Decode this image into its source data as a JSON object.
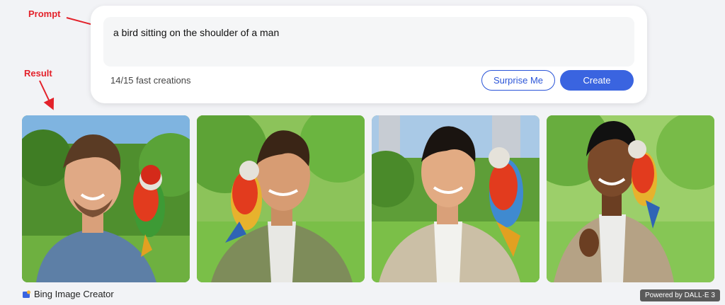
{
  "annotations": {
    "prompt_label": "Prompt",
    "result_label": "Result",
    "color": "#e3222b"
  },
  "prompt": {
    "value": "a bird sitting on the shoulder of a man",
    "fast_creations": "14/15 fast creations"
  },
  "buttons": {
    "surprise_label": "Surprise Me",
    "create_label": "Create"
  },
  "images": [
    {
      "subject": "man-with-parrot-1"
    },
    {
      "subject": "man-with-parrot-2"
    },
    {
      "subject": "man-with-parrot-3"
    },
    {
      "subject": "man-with-parrot-4"
    }
  ],
  "footer": {
    "brand": "Bing Image Creator",
    "badge": "Powered by DALL·E 3"
  },
  "colors": {
    "accent": "#3a64e0",
    "accent_border": "#2b55d8"
  }
}
